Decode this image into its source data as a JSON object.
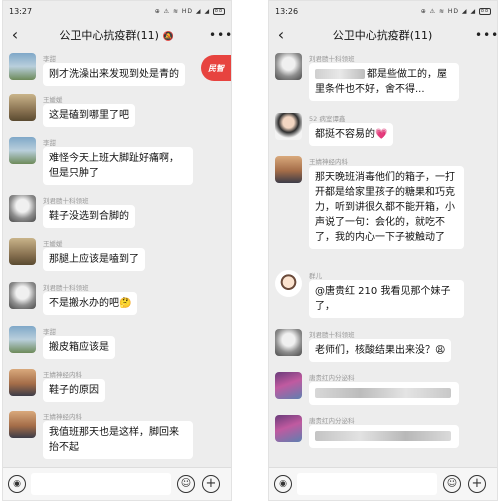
{
  "screen_left": {
    "status": {
      "time": "13:27",
      "icons": "⊕ ⚠ ≋ HD ◢ ◢",
      "battery": "88"
    },
    "header": {
      "back": "‹",
      "title": "公卫中心抗疫群(11)",
      "mute": "🔕",
      "more": "⊕"
    },
    "badge": "民智",
    "messages": [
      {
        "sender": "李甜",
        "text": "刚才洗澡出来发现到处是青的"
      },
      {
        "sender": "王媛媛",
        "text": "这是磕到哪里了吧"
      },
      {
        "sender": "李甜",
        "text": "难怪今天上班大脚趾好痛啊，但是只肿了"
      },
      {
        "sender": "刘君赜十科领班",
        "text": "鞋子没选到合脚的"
      },
      {
        "sender": "王媛媛",
        "text": "那腿上应该是嗑到了"
      },
      {
        "sender": "刘君赜十科领班",
        "text": "不是搬水办的吧🤔"
      },
      {
        "sender": "李甜",
        "text": "搬皮箱应该是"
      },
      {
        "sender": "王婧神经内科",
        "text": "鞋子的原因"
      },
      {
        "sender": "王婧神经内科",
        "text": "我值班那天也是这样，脚回来抬不起"
      }
    ]
  },
  "screen_right": {
    "status": {
      "time": "13:26",
      "icons": "⊕ ⚠ ≋ HD ◢ ◢",
      "battery": "88"
    },
    "header": {
      "back": "‹",
      "title": "公卫中心抗疫群(11)",
      "mute": "",
      "more": "⊕"
    },
    "messages": [
      {
        "sender": "刘君赜十科领班",
        "text_visible": "都是些做工的，屋里条件也不好，舍不得..."
      },
      {
        "sender": "52 病室谭鑫",
        "text": "都挺不容易的💗"
      },
      {
        "sender": "王婧神经内科",
        "text": "那天晚班消毒他们的箱子，一打开都是给家里孩子的糖果和巧克力，听到讲很久都不能开箱，小声说了一句：会化的，就吃不了，我的内心一下子被触动了"
      },
      {
        "sender": "群儿",
        "text": "@唐贵红 210  我看见那个妹子了，"
      },
      {
        "sender": "刘君赜十科领班",
        "text": "老师们，核酸结果出来没？😩"
      },
      {
        "sender": "唐贵红内分泌科",
        "text": ""
      },
      {
        "sender": "唐贵红内分泌科",
        "text": ""
      }
    ]
  },
  "inputbar": {
    "voice_icon": "voice-icon",
    "emoji_icon": "emoji-icon",
    "plus_icon": "plus-icon"
  },
  "colors": {
    "chat_bg": "#ededed",
    "bubble": "#ffffff",
    "accent_red": "#e7433f"
  }
}
